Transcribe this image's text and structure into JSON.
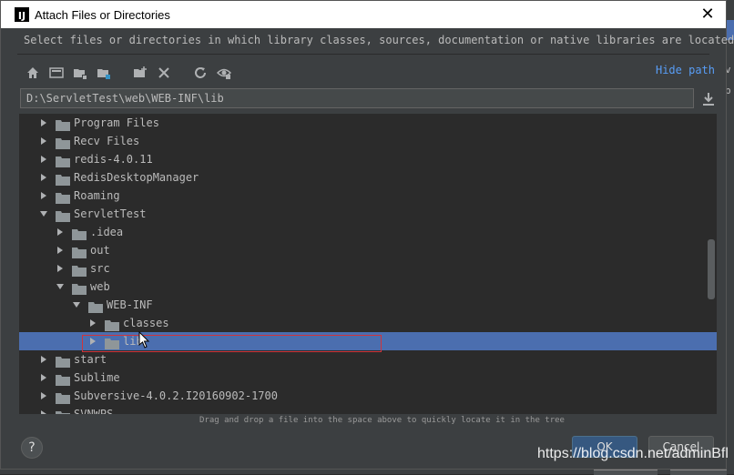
{
  "window": {
    "title": "Attach Files or Directories",
    "app_icon_letter": "IJ",
    "close_glyph": "✕"
  },
  "description": "Select files or directories in which library classes, sources, documentation or native libraries are located",
  "toolbar": {
    "icons": [
      "home-icon",
      "desktop-icon",
      "project-folder-icon",
      "module-folder-icon",
      "new-folder-icon",
      "delete-icon",
      "refresh-icon",
      "show-hidden-icon"
    ],
    "hide_path_label": "Hide path"
  },
  "path": {
    "value": "D:\\ServletTest\\web\\WEB-INF\\lib"
  },
  "tree": {
    "rows": [
      {
        "name": "Program Files",
        "depth": 0,
        "expanded": false
      },
      {
        "name": "Recv Files",
        "depth": 0,
        "expanded": false
      },
      {
        "name": "redis-4.0.11",
        "depth": 0,
        "expanded": false
      },
      {
        "name": "RedisDesktopManager",
        "depth": 0,
        "expanded": false
      },
      {
        "name": "Roaming",
        "depth": 0,
        "expanded": false
      },
      {
        "name": "ServletTest",
        "depth": 0,
        "expanded": true
      },
      {
        "name": ".idea",
        "depth": 1,
        "expanded": false
      },
      {
        "name": "out",
        "depth": 1,
        "expanded": false
      },
      {
        "name": "src",
        "depth": 1,
        "expanded": false
      },
      {
        "name": "web",
        "depth": 1,
        "expanded": true
      },
      {
        "name": "WEB-INF",
        "depth": 2,
        "expanded": true
      },
      {
        "name": "classes",
        "depth": 3,
        "expanded": false
      },
      {
        "name": "lib",
        "depth": 3,
        "expanded": false,
        "selected": true
      },
      {
        "name": "start",
        "depth": 0,
        "expanded": false
      },
      {
        "name": "Sublime",
        "depth": 0,
        "expanded": false
      },
      {
        "name": "Subversive-4.0.2.I20160902-1700",
        "depth": 0,
        "expanded": false
      },
      {
        "name": "SVNWPS",
        "depth": 0,
        "expanded": false
      }
    ]
  },
  "hint": "Drag and drop a file into the space above to quickly locate it in the tree",
  "buttons": {
    "help": "?",
    "ok": "OK",
    "cancel": "Cancel"
  },
  "watermark": "https://blog.csdn.net/adminBfl",
  "background_window": {
    "fragments": [
      "v",
      "p"
    ]
  },
  "colors": {
    "selection": "#4b6eaf",
    "link": "#589df6",
    "highlight_box": "#d0343a",
    "folder": "#8f9699"
  }
}
